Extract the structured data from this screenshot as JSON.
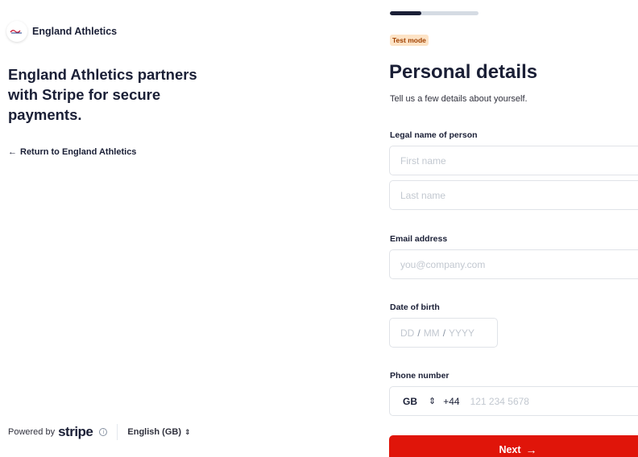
{
  "brand": {
    "name": "England Athletics",
    "logo_icon": "england-athletics-logo"
  },
  "headline": "England Athletics partners with Stripe for secure payments.",
  "return_link": {
    "arrow": "←",
    "label": "Return to England Athletics"
  },
  "footer": {
    "powered_by": "Powered by",
    "stripe": "stripe",
    "info_icon": "ⓘ",
    "language": "English (GB)",
    "language_chevron": "⌃⌄"
  },
  "progress": {
    "value": 0.35
  },
  "badge": "Test mode",
  "title": "Personal details",
  "subtitle": "Tell us a few details about yourself.",
  "legal_name": {
    "label": "Legal name of person",
    "first_placeholder": "First name",
    "last_placeholder": "Last name"
  },
  "email": {
    "label": "Email address",
    "placeholder": "you@company.com"
  },
  "dob": {
    "label": "Date of birth",
    "dd": "DD",
    "mm": "MM",
    "yyyy": "YYYY",
    "sep": "/"
  },
  "phone": {
    "label": "Phone number",
    "country": "GB",
    "code": "+44",
    "placeholder": "121 234 5678"
  },
  "next_button": {
    "label": "Next",
    "arrow": "→"
  },
  "colors": {
    "accent": "#e0150a",
    "text": "#1a1f36",
    "badge_bg": "#fde3c6",
    "badge_text": "#a04100"
  }
}
